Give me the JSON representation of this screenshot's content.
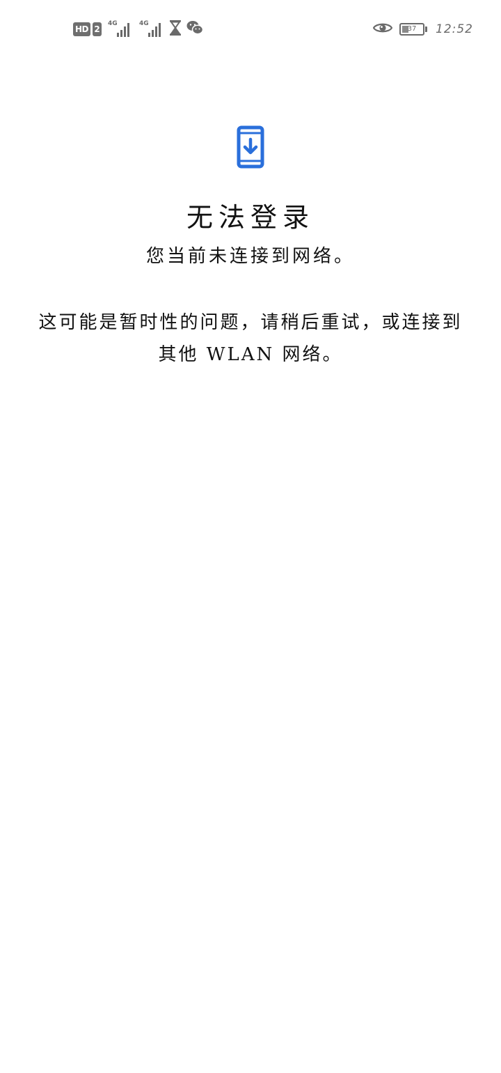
{
  "status_bar": {
    "hd_label": "HD",
    "sim_label": "2",
    "signal_1_network": "4G",
    "signal_2_network": "4G",
    "battery_level": "37",
    "time": "12:52",
    "icons": [
      "hd-icon",
      "sim-2-icon",
      "signal-4g-icon",
      "signal-4g-icon",
      "hourglass-icon",
      "wechat-icon",
      "eye-icon",
      "battery-icon"
    ]
  },
  "main": {
    "icon": "phone-download-icon",
    "accent_color": "#2a6fdb",
    "title": "无法登录",
    "subtitle": "您当前未连接到网络。",
    "description": "这可能是暂时性的问题，请稍后重试，或连接到其他 WLAN 网络。"
  }
}
